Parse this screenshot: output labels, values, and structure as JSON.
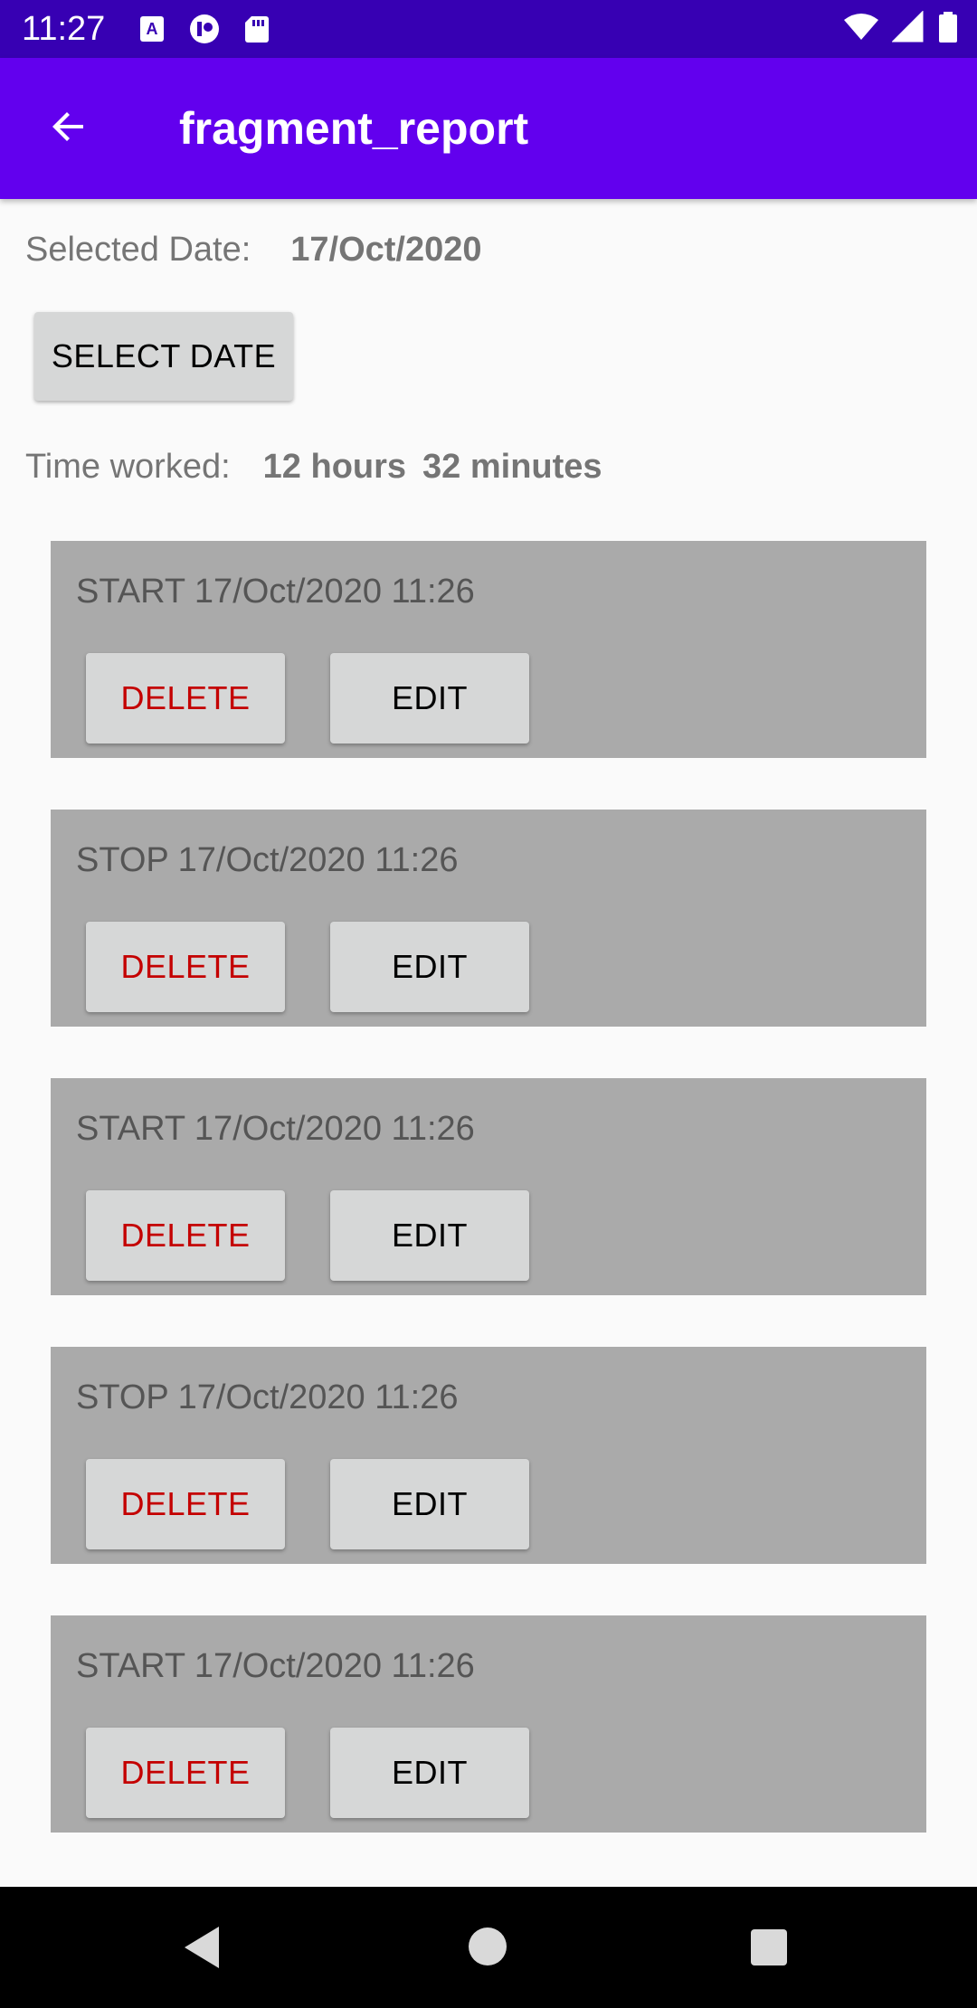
{
  "status_bar": {
    "time": "11:27",
    "left_icons": [
      "font-icon",
      "profile-icon",
      "sd-card-icon"
    ],
    "right_icons": [
      "wifi-icon",
      "signal-icon",
      "battery-icon"
    ]
  },
  "app_bar": {
    "title": "fragment_report",
    "back_icon": "arrow-back-icon",
    "color": "#6200ee"
  },
  "report": {
    "selected_date_label": "Selected Date:",
    "selected_date_value": "17/Oct/2020",
    "select_date_button": "SELECT DATE",
    "time_worked_label": "Time worked:",
    "time_worked_hours": "12 hours",
    "time_worked_minutes": "32 minutes"
  },
  "entries": [
    {
      "label": "START 17/Oct/2020 11:26",
      "delete_label": "DELETE",
      "edit_label": "EDIT"
    },
    {
      "label": "STOP 17/Oct/2020 11:26",
      "delete_label": "DELETE",
      "edit_label": "EDIT"
    },
    {
      "label": "START 17/Oct/2020 11:26",
      "delete_label": "DELETE",
      "edit_label": "EDIT"
    },
    {
      "label": "STOP 17/Oct/2020 11:26",
      "delete_label": "DELETE",
      "edit_label": "EDIT"
    },
    {
      "label": "START 17/Oct/2020 11:26",
      "delete_label": "DELETE",
      "edit_label": "EDIT"
    }
  ],
  "colors": {
    "status_bar": "#3700b3",
    "delete_text": "#c40000",
    "entry_background": "#aaaaaa"
  },
  "nav_bar": {
    "icons": [
      "nav-back-icon",
      "nav-home-icon",
      "nav-recents-icon"
    ]
  }
}
